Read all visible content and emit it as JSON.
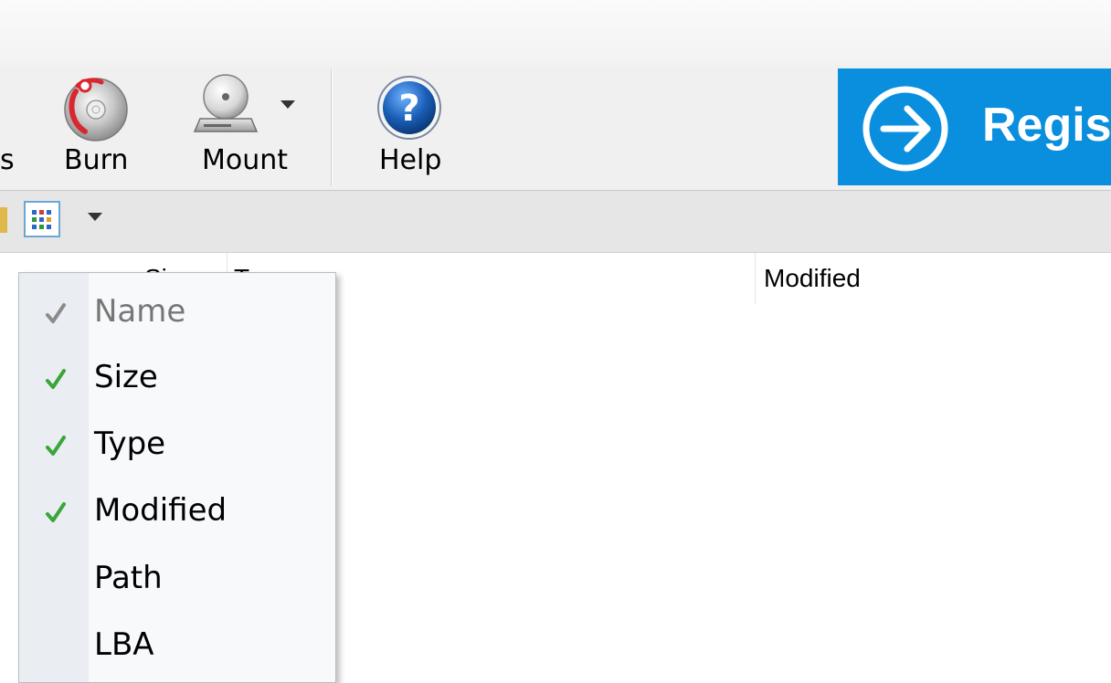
{
  "toolbar": {
    "partial_label": "s",
    "burn_label": "Burn",
    "mount_label": "Mount",
    "help_label": "Help",
    "register_label": "Regis"
  },
  "columns": {
    "size_partial": "Si",
    "type_partial": "T",
    "modified": "Modified"
  },
  "column_menu": {
    "items": [
      {
        "label": "Name",
        "checked": true,
        "enabled": false
      },
      {
        "label": "Size",
        "checked": true,
        "enabled": true
      },
      {
        "label": "Type",
        "checked": true,
        "enabled": true
      },
      {
        "label": "Modified",
        "checked": true,
        "enabled": true
      },
      {
        "label": "Path",
        "checked": false,
        "enabled": true
      },
      {
        "label": "LBA",
        "checked": false,
        "enabled": true
      }
    ]
  },
  "colors": {
    "register_bg": "#0a8fdf",
    "check_enabled": "#3aa53a",
    "check_disabled": "#8a8a8a",
    "help_blue": "#1b5fb8",
    "burn_red": "#d8282f"
  },
  "icons": {
    "burn": "burn-disc-icon",
    "mount": "mount-drive-icon",
    "help": "help-question-icon",
    "register": "arrow-right-circle-icon",
    "view": "view-columns-icon"
  }
}
